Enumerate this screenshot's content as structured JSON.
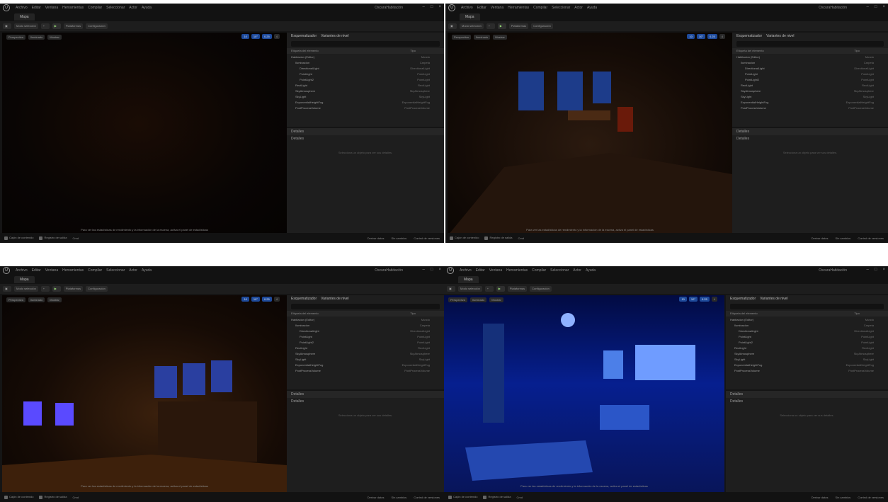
{
  "menu": [
    "Archivo",
    "Editar",
    "Ventana",
    "Herramientas",
    "Compilar",
    "Seleccionar",
    "Actor",
    "Ayuda"
  ],
  "project_name": "OscuraHabitación",
  "map_tab": "Mapa",
  "toolbar": {
    "modes": "Modo selección",
    "platforms": "Plataformas",
    "settings": "Configuración"
  },
  "viewport_buttons": [
    "Perspectiva",
    "Iluminado",
    "Mostrar"
  ],
  "viewport_right": [
    "10",
    "10°",
    "0.25",
    "4"
  ],
  "outliner": {
    "title": "Esquematizador",
    "tab2": "Variantes de nivel",
    "col_label": "Etiqueta del elemento",
    "col_type": "Tipo",
    "rows": [
      {
        "label": "Habitacion (Editor)",
        "type": "Mundo"
      },
      {
        "label": "Iluminacion",
        "type": "Carpeta"
      },
      {
        "label": "DirectionalLight",
        "type": "DirectionalLight"
      },
      {
        "label": "PointLight",
        "type": "PointLight"
      },
      {
        "label": "PointLight2",
        "type": "PointLight"
      },
      {
        "label": "RectLight",
        "type": "RectLight"
      },
      {
        "label": "SkyAtmosphere",
        "type": "SkyAtmosphere"
      },
      {
        "label": "SkyLight",
        "type": "SkyLight"
      },
      {
        "label": "ExponentialHeightFog",
        "type": "ExponentialHeightFog"
      },
      {
        "label": "PostProcessVolume",
        "type": "PostProcessVolume"
      }
    ]
  },
  "details": {
    "tab": "Detalles",
    "sub": "Detalles",
    "empty": "Selecciona un objeto para ver sus detalles."
  },
  "caption": "Para ver las estadísticas de rendimiento y la información de la escena, activa el panel de estadísticas",
  "status": {
    "left": [
      "Cajón de contenido",
      "Registro de salida",
      "Cmd"
    ],
    "right": [
      "Derivar datos",
      "Sin cambios",
      "Control de versiones"
    ]
  }
}
